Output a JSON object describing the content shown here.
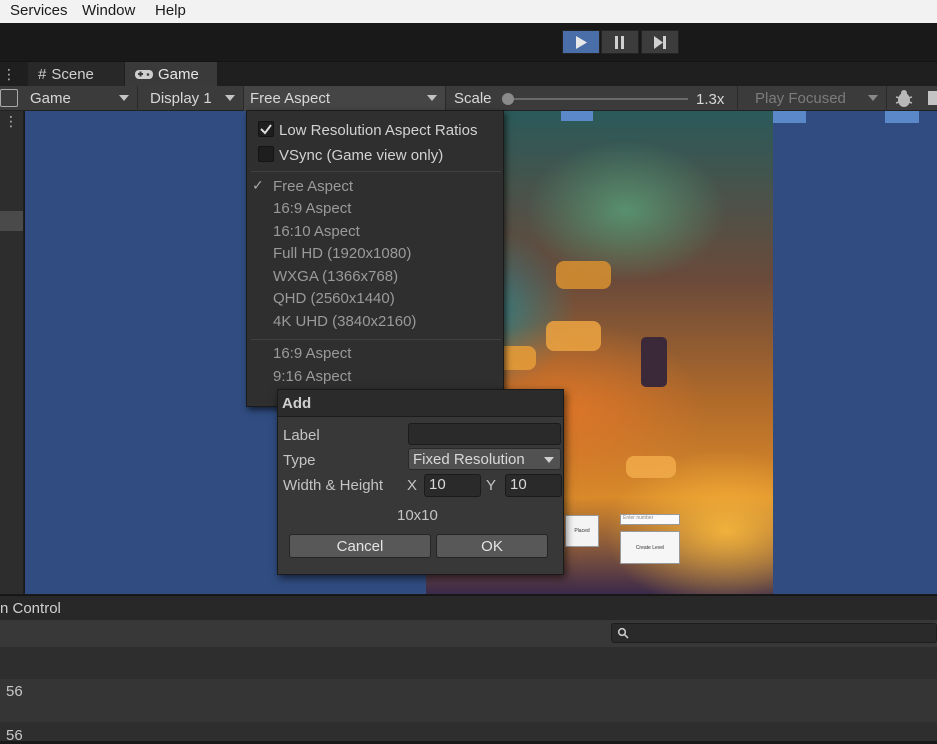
{
  "menubar": {
    "items": [
      "Services",
      "Window",
      "Help"
    ]
  },
  "tabs": {
    "scene": "Scene",
    "game": "Game"
  },
  "game_toolbar": {
    "mode": "Game",
    "display": "Display 1",
    "aspect": "Free Aspect",
    "scale_label": "Scale",
    "scale_value": "1.3x",
    "scale_fraction": 0.0,
    "play_focused": "Play Focused"
  },
  "aspect_menu": {
    "low_res_label": "Low Resolution Aspect Ratios",
    "low_res_checked": true,
    "vsync_label": "VSync (Game view only)",
    "vsync_checked": false,
    "items": [
      "Free Aspect",
      "16:9 Aspect",
      "16:10 Aspect",
      "Full HD (1920x1080)",
      "WXGA (1366x768)",
      "QHD (2560x1440)",
      "4K UHD (3840x2160)"
    ],
    "selected": "Free Aspect",
    "custom_items": [
      "16:9 Aspect",
      "9:16 Aspect"
    ]
  },
  "add_dialog": {
    "title": "Add",
    "label_label": "Label",
    "label_value": "",
    "type_label": "Type",
    "type_value": "Fixed Resolution",
    "wh_label": "Width & Height",
    "x_label": "X",
    "x_value": "10",
    "y_label": "Y",
    "y_value": "10",
    "preview": "10x10",
    "cancel": "Cancel",
    "ok": "OK"
  },
  "game_overlay": {
    "button1": "Placed",
    "input_placeholder": "Enter number",
    "button2": "Create Level"
  },
  "bottom_panel": {
    "tab_label": "n Control",
    "rows": [
      "56",
      "56"
    ]
  }
}
